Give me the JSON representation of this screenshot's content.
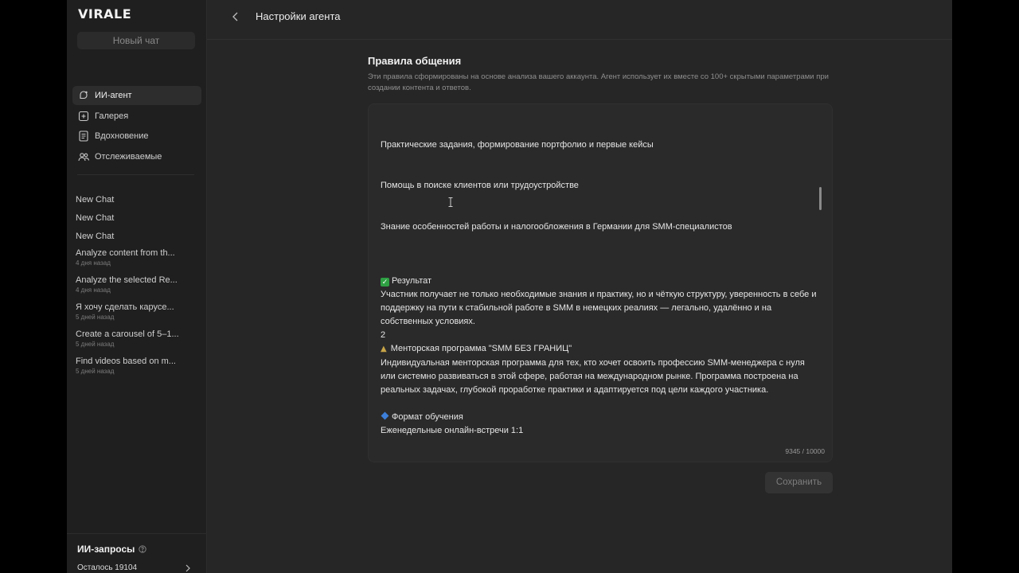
{
  "app": {
    "logo": "VIRALE",
    "new_chat_label": "Новый чат"
  },
  "nav": {
    "items": [
      {
        "label": "ИИ-агент",
        "icon": "ai-agent-icon",
        "active": true
      },
      {
        "label": "Галерея",
        "icon": "gallery-icon"
      },
      {
        "label": "Вдохновение",
        "icon": "inspiration-icon"
      },
      {
        "label": "Отслеживаемые",
        "icon": "tracked-users-icon"
      }
    ]
  },
  "chats": [
    {
      "title": "New Chat",
      "date": ""
    },
    {
      "title": "New Chat",
      "date": ""
    },
    {
      "title": "New Chat",
      "date": ""
    },
    {
      "title": "Analyze content from th...",
      "date": "4 дня назад"
    },
    {
      "title": "Analyze the selected Re...",
      "date": "4 дня назад"
    },
    {
      "title": "Я хочу сделать карусе...",
      "date": "5 дней назад"
    },
    {
      "title": "Create a carousel of 5–1...",
      "date": "5 дней назад"
    },
    {
      "title": "Find videos based on m...",
      "date": "5 дней назад"
    }
  ],
  "quota": {
    "title": "ИИ-запросы",
    "remaining": "Осталось 19104"
  },
  "header": {
    "title": "Настройки агента"
  },
  "main": {
    "section_title": "Правила общения",
    "section_desc": "Эти правила сформированы на основе анализа вашего аккаунта. Агент использует их вместе со 100+ скрытыми параметрами при создании контента и ответов.",
    "editor": {
      "line1": "Практические задания, формирование портфолио и первые кейсы",
      "line2": "Помощь в поиске клиентов или трудоустройстве",
      "line3": "Знание особенностей работы и налогообложения в Германии для SMM-специалистов",
      "result_heading": "Результат",
      "result_text": "Участник получает не только необходимые знания и практику, но и чёткую структуру, уверенность в себе и поддержку на пути к стабильной работе в SMM в немецких реалиях — легально, удалённо и на собственных условиях.",
      "number": "2",
      "program_heading": "Менторская программа \"SMM БЕЗ ГРАНИЦ\"",
      "program_text": "Индивидуальная менторская программа для тех, кто хочет освоить профессию SMM-менеджера с нуля или системно развиваться в этой сфере, работая на международном рынке. Программа построена на реальных задачах, глубокой проработке практики и адаптируется под цели каждого участника.",
      "format_heading": "Формат обучения",
      "format_text": "Еженедельные онлайн-встречи  1:1",
      "counter": "9345 / 10000"
    },
    "save_label": "Сохранить"
  }
}
